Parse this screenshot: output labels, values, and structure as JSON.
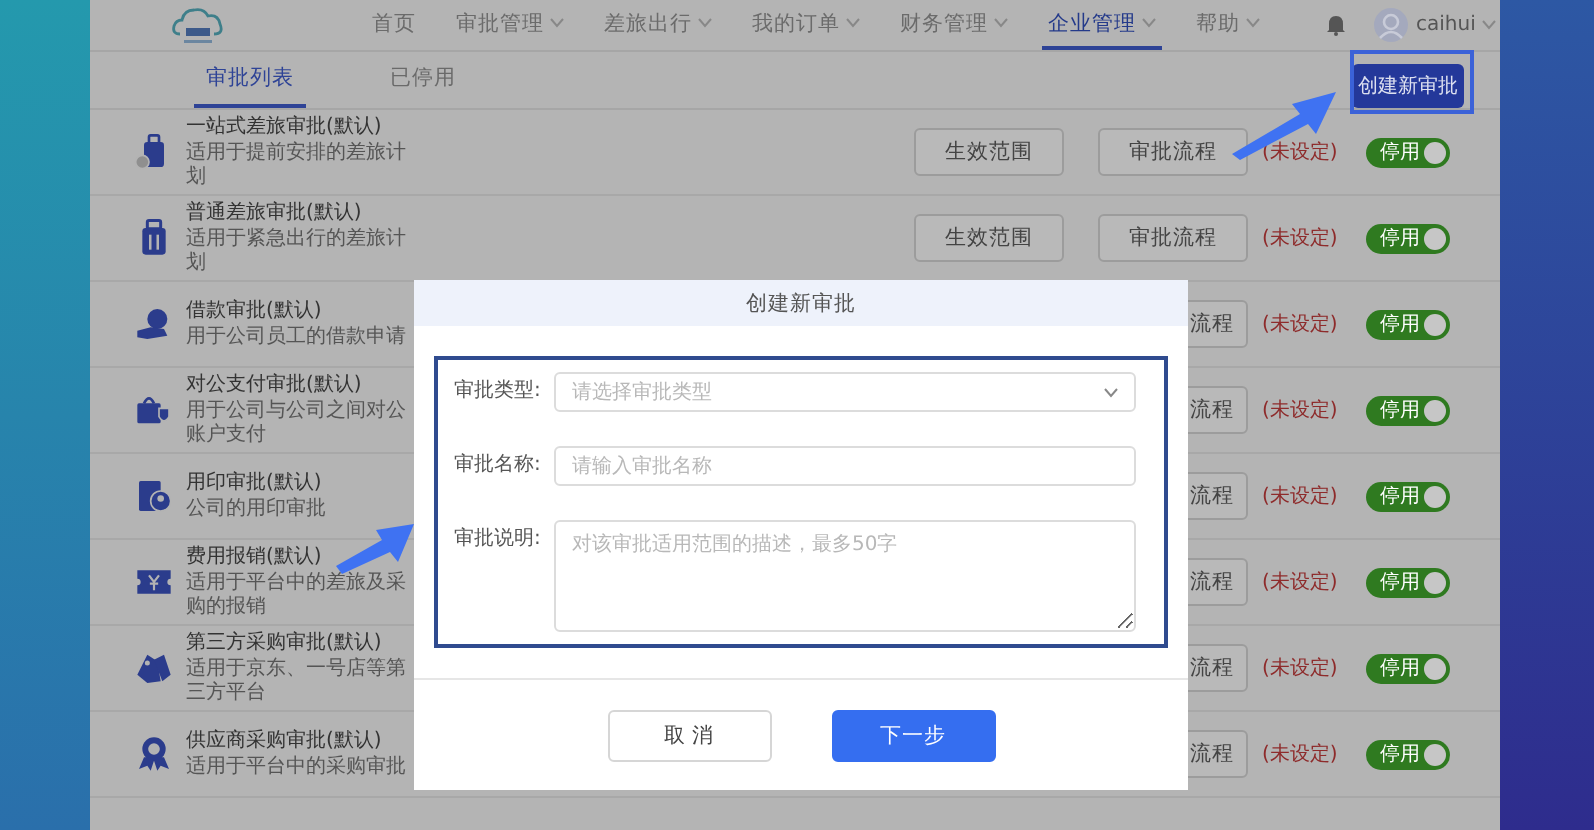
{
  "nav": {
    "items": [
      {
        "label": "首页",
        "dropdown": false,
        "selected": false
      },
      {
        "label": "审批管理",
        "dropdown": true,
        "selected": false
      },
      {
        "label": "差旅出行",
        "dropdown": true,
        "selected": false
      },
      {
        "label": "我的订单",
        "dropdown": true,
        "selected": false
      },
      {
        "label": "财务管理",
        "dropdown": true,
        "selected": false
      },
      {
        "label": "企业管理",
        "dropdown": true,
        "selected": true
      },
      {
        "label": "帮助",
        "dropdown": true,
        "selected": false
      }
    ],
    "user": "caihui"
  },
  "tabs": [
    {
      "label": "审批列表",
      "selected": true
    },
    {
      "label": "已停用",
      "selected": false
    }
  ],
  "create_button": "创建新审批",
  "rows": [
    {
      "kind": "suitcase-badge",
      "title": "一站式差旅审批(默认)",
      "description": "适用于提前安排的差旅计划",
      "scope_button": "生效范围",
      "flow_button": "审批流程",
      "flow_status": "(未设定)",
      "toggle": {
        "label": "停用",
        "on": true
      }
    },
    {
      "kind": "suitcase",
      "title": "普通差旅审批(默认)",
      "description": "适用于紧急出行的差旅计划",
      "scope_button": "生效范围",
      "flow_button": "审批流程",
      "flow_status": "(未设定)",
      "toggle": {
        "label": "停用",
        "on": true
      }
    },
    {
      "kind": "hand-coin",
      "title": "借款审批(默认)",
      "description": "用于公司员工的借款申请",
      "flow_button": "流程",
      "flow_status": "(未设定)",
      "toggle": {
        "label": "停用",
        "on": true
      }
    },
    {
      "kind": "bag-shield",
      "title": "对公支付审批(默认)",
      "description": "用于公司与公司之间对公账户支付",
      "flow_button": "流程",
      "flow_status": "(未设定)",
      "toggle": {
        "label": "停用",
        "on": true
      }
    },
    {
      "kind": "card-person",
      "title": "用印审批(默认)",
      "description": "公司的用印审批",
      "flow_button": "流程",
      "flow_status": "(未设定)",
      "toggle": {
        "label": "停用",
        "on": true
      }
    },
    {
      "kind": "ticket",
      "title": "费用报销(默认)",
      "description": "适用于平台中的差旅及采购的报销",
      "flow_button": "流程",
      "flow_status": "(未设定)",
      "toggle": {
        "label": "停用",
        "on": true
      }
    },
    {
      "kind": "tag",
      "title": "第三方采购审批(默认)",
      "description": "适用于京东、一号店等第三方平台",
      "flow_button": "流程",
      "flow_status": "(未设定)",
      "toggle": {
        "label": "停用",
        "on": true
      }
    },
    {
      "kind": "award",
      "title": "供应商采购审批(默认)",
      "description": "适用于平台中的采购审批",
      "flow_button": "流程",
      "flow_status": "(未设定)",
      "toggle": {
        "label": "停用",
        "on": true
      }
    }
  ],
  "dialog": {
    "title": "创建新审批",
    "fields": [
      {
        "kind": "select",
        "label": "审批类型:",
        "placeholder": "请选择审批类型"
      },
      {
        "kind": "input",
        "label": "审批名称:",
        "placeholder": "请输入审批名称"
      },
      {
        "kind": "textarea",
        "label": "审批说明:",
        "placeholder": "对该审批适用范围的描述，最多50字"
      }
    ],
    "buttons": [
      {
        "label": "取 消",
        "kind": "secondary"
      },
      {
        "label": "下一步",
        "kind": "primary"
      }
    ]
  }
}
